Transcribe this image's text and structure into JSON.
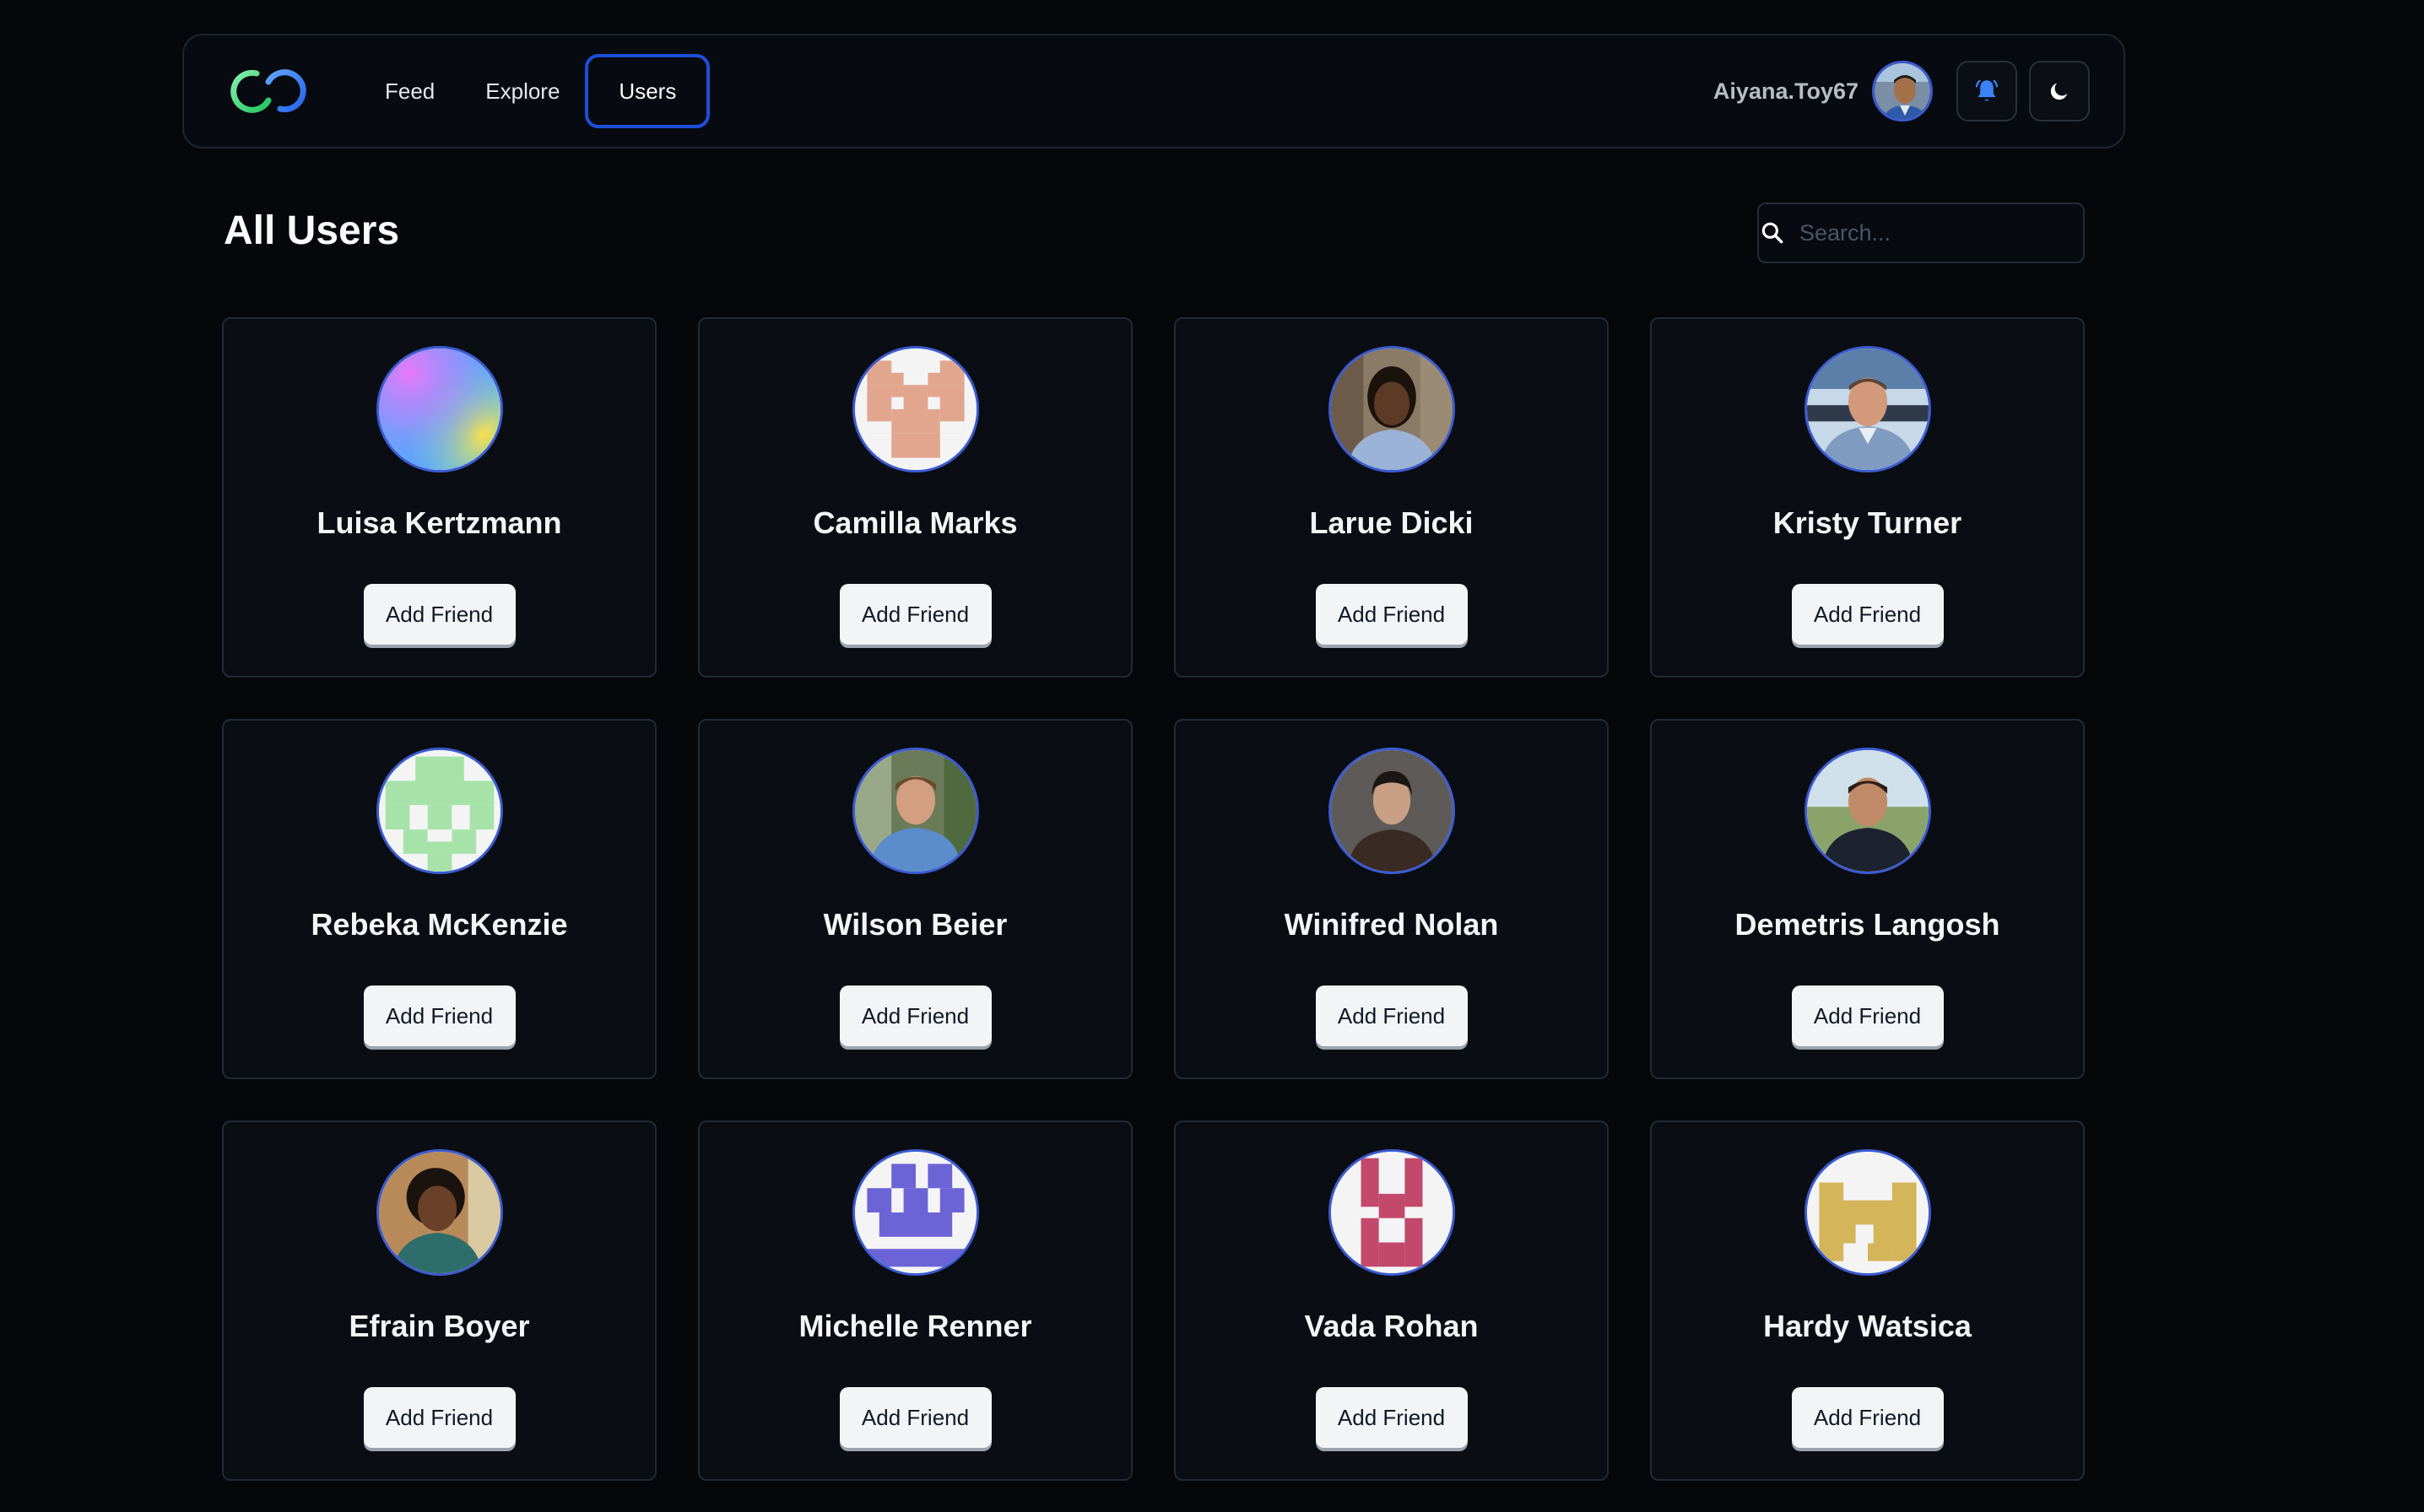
{
  "nav": {
    "links": [
      {
        "label": "Feed",
        "active": false
      },
      {
        "label": "Explore",
        "active": false
      },
      {
        "label": "Users",
        "active": true
      }
    ],
    "username": "Aiyana.Toy67",
    "accent_color": "#1d4ed8",
    "notification_icon": "bell-icon",
    "theme_icon": "moon-icon"
  },
  "page": {
    "title": "All Users"
  },
  "search": {
    "placeholder": "Search...",
    "value": ""
  },
  "users": [
    {
      "name": "Luisa Kertzmann",
      "button": "Add Friend",
      "avatar": "gradient"
    },
    {
      "name": "Camilla Marks",
      "button": "Add Friend",
      "avatar": "identicon-salmon"
    },
    {
      "name": "Larue Dicki",
      "button": "Add Friend",
      "avatar": "photo"
    },
    {
      "name": "Kristy Turner",
      "button": "Add Friend",
      "avatar": "photo"
    },
    {
      "name": "Rebeka McKenzie",
      "button": "Add Friend",
      "avatar": "identicon-green"
    },
    {
      "name": "Wilson Beier",
      "button": "Add Friend",
      "avatar": "photo"
    },
    {
      "name": "Winifred Nolan",
      "button": "Add Friend",
      "avatar": "photo"
    },
    {
      "name": "Demetris Langosh",
      "button": "Add Friend",
      "avatar": "photo"
    },
    {
      "name": "Efrain Boyer",
      "button": "Add Friend",
      "avatar": "photo"
    },
    {
      "name": "Michelle Renner",
      "button": "Add Friend",
      "avatar": "identicon-indigo"
    },
    {
      "name": "Vada Rohan",
      "button": "Add Friend",
      "avatar": "identicon-pink"
    },
    {
      "name": "Hardy Watsica",
      "button": "Add Friend",
      "avatar": "identicon-gold"
    }
  ]
}
